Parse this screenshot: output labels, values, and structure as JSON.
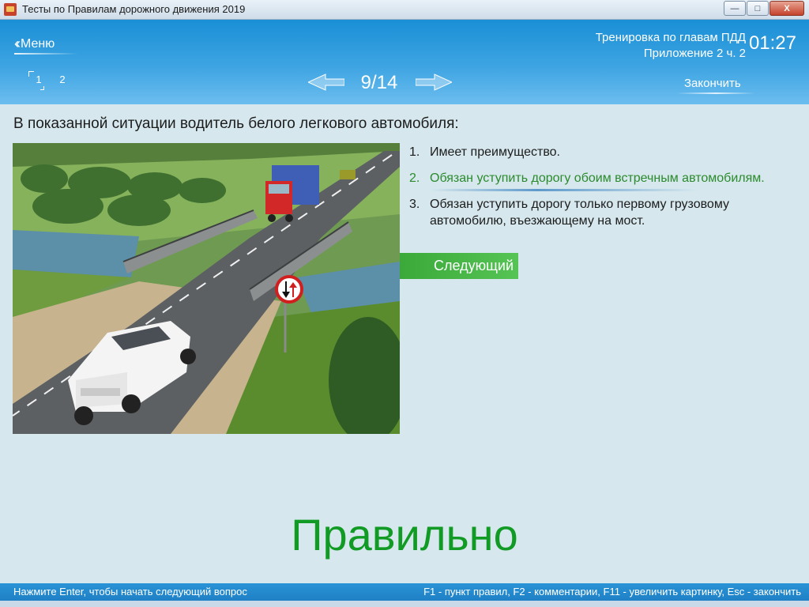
{
  "window": {
    "title": "Тесты по Правилам дорожного движения 2019",
    "controls": {
      "minimize": "—",
      "maximize": "□",
      "close": "X"
    }
  },
  "header": {
    "menu_label": "Меню",
    "mode_line1": "Тренировка по главам ПДД",
    "mode_line2": "Приложение 2 ч. 2",
    "timer": "01:27",
    "question_tabs": [
      "1",
      "2"
    ],
    "counter": "9/14",
    "finish_label": "Закончить"
  },
  "question": {
    "text": "В показанной ситуации водитель белого легкового автомобиля:",
    "answers": [
      {
        "num": "1.",
        "text": "Имеет преимущество."
      },
      {
        "num": "2.",
        "text": "Обязан уступить дорогу обоим встречным автомобилям."
      },
      {
        "num": "3.",
        "text": "Обязан уступить дорогу только первому грузовому автомобилю, въезжающему на мост."
      }
    ],
    "next_label": "Следующий",
    "result": "Правильно"
  },
  "status": {
    "left_hint": "Нажмите Enter, чтобы начать следующий вопрос",
    "right_hint": "F1 - пункт правил, F2 - комментарии, F11 - увеличить картинку, Esc - закончить"
  },
  "colors": {
    "header_blue": "#1a8fd6",
    "correct_green": "#2b8a2b",
    "result_green": "#119b25",
    "next_button_green": "#3aa93a"
  },
  "icons": {
    "menu": "chevron-double-left-icon",
    "prev": "arrow-left-icon",
    "next": "arrow-right-icon",
    "road_sign": "oncoming-priority-sign-icon"
  }
}
